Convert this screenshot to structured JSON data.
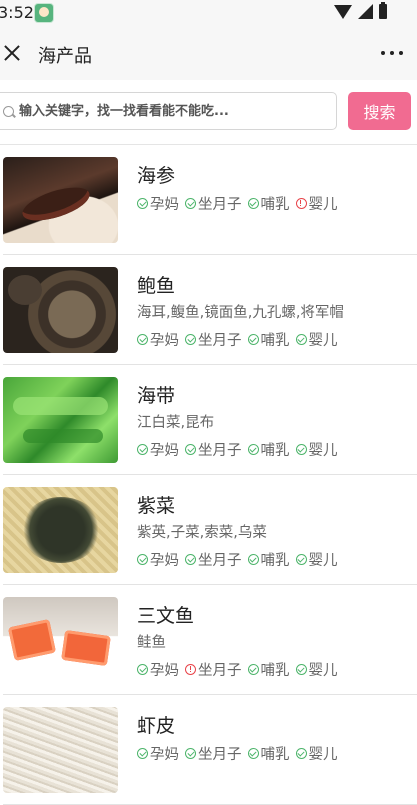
{
  "status_bar": {
    "time": "3:52"
  },
  "nav": {
    "title": "海产品"
  },
  "search": {
    "placeholder": "输入关键字，找一找看看能不能吃...",
    "button_label": "搜索"
  },
  "tag_labels": [
    "孕妈",
    "坐月子",
    "哺乳",
    "婴儿"
  ],
  "items": [
    {
      "name": "海参",
      "aliases": "",
      "tags": [
        {
          "label": "孕妈",
          "status": "ok"
        },
        {
          "label": "坐月子",
          "status": "ok"
        },
        {
          "label": "哺乳",
          "status": "ok"
        },
        {
          "label": "婴儿",
          "status": "warn"
        }
      ]
    },
    {
      "name": "鲍鱼",
      "aliases": "海耳,鳆鱼,镜面鱼,九孔螺,将军帽",
      "tags": [
        {
          "label": "孕妈",
          "status": "ok"
        },
        {
          "label": "坐月子",
          "status": "ok"
        },
        {
          "label": "哺乳",
          "status": "ok"
        },
        {
          "label": "婴儿",
          "status": "ok"
        }
      ]
    },
    {
      "name": "海带",
      "aliases": "江白菜,昆布",
      "tags": [
        {
          "label": "孕妈",
          "status": "ok"
        },
        {
          "label": "坐月子",
          "status": "ok"
        },
        {
          "label": "哺乳",
          "status": "ok"
        },
        {
          "label": "婴儿",
          "status": "ok"
        }
      ]
    },
    {
      "name": "紫菜",
      "aliases": "紫英,子菜,索菜,乌菜",
      "tags": [
        {
          "label": "孕妈",
          "status": "ok"
        },
        {
          "label": "坐月子",
          "status": "ok"
        },
        {
          "label": "哺乳",
          "status": "ok"
        },
        {
          "label": "婴儿",
          "status": "ok"
        }
      ]
    },
    {
      "name": "三文鱼",
      "aliases": "鲑鱼",
      "tags": [
        {
          "label": "孕妈",
          "status": "ok"
        },
        {
          "label": "坐月子",
          "status": "warn"
        },
        {
          "label": "哺乳",
          "status": "ok"
        },
        {
          "label": "婴儿",
          "status": "ok"
        }
      ]
    },
    {
      "name": "虾皮",
      "aliases": "",
      "tags": [
        {
          "label": "孕妈",
          "status": "ok"
        },
        {
          "label": "坐月子",
          "status": "ok"
        },
        {
          "label": "哺乳",
          "status": "ok"
        },
        {
          "label": "婴儿",
          "status": "ok"
        }
      ]
    }
  ],
  "colors": {
    "accent": "#f16b91",
    "ok": "#4cb46a",
    "warn": "#e8444a"
  }
}
